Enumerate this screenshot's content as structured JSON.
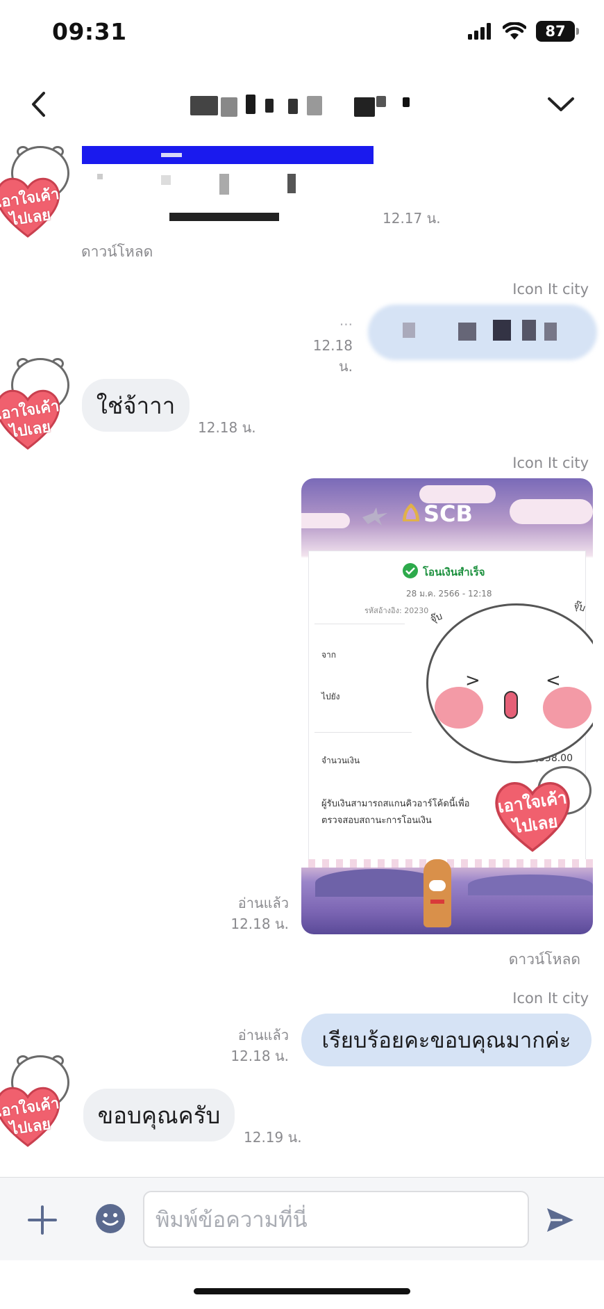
{
  "status_bar": {
    "time": "09:31",
    "battery": "87"
  },
  "header": {
    "title": ""
  },
  "messages": {
    "m1": {
      "time": "12.17 น.",
      "download": "ดาวน์โหลด"
    },
    "m2": {
      "sender": "Icon It city",
      "time": "12.18 น."
    },
    "m3": {
      "text": "ใช่จ้าาา",
      "time": "12.18 น."
    },
    "m4": {
      "sender": "Icon It city",
      "read": "อ่านแล้ว",
      "time": "12.18 น.",
      "download": "ดาวน์โหลด"
    },
    "m5": {
      "sender": "Icon It city",
      "read": "อ่านแล้ว",
      "time": "12.18 น.",
      "text": "เรียบร้อยคะขอบคุณมากค่ะ"
    },
    "m6": {
      "text": "ขอบคุณครับ",
      "time": "12.19 น."
    }
  },
  "slip": {
    "bank": "SCB",
    "status": "โอนเงินสำเร็จ",
    "date": "28 ม.ค. 2566 - 12:18",
    "ref": "รหัสอ้างอิง: 20230",
    "from_label": "จาก",
    "to_label": "ไปยัง",
    "amount_label": "จำนวนเงิน",
    "amount": "2,338.00",
    "note_line1": "ผู้รับเงินสามารถสแกนคิวอาร์โค้ดนี้เพื่อ",
    "note_line2": "ตรวจสอบสถานะการโอนเงิน",
    "sticker_sound": "จุ๊บ"
  },
  "stickers": {
    "heart_text_1": "เอาใจเค้า",
    "heart_text_2": "ไปเลย"
  },
  "input": {
    "placeholder": "พิมพ์ข้อความที่นี่"
  },
  "colors": {
    "bubble_in": "#eef0f3",
    "bubble_out": "#d6e3f5",
    "accent": "#5b6a8f",
    "heart": "#f0606e"
  }
}
